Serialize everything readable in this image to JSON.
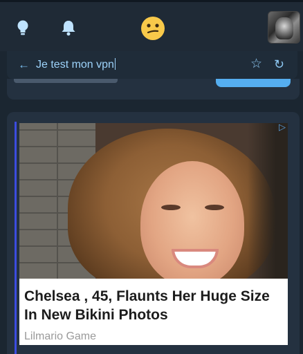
{
  "toolbar": {
    "icons": [
      "lightbulb-icon",
      "bell-icon",
      "smiley-icon",
      "profile-avatar"
    ]
  },
  "address_bar": {
    "title": "Je test mon vpn",
    "back_icon": "arrow-left-icon",
    "star_icon": "star-icon",
    "reload_icon": "reload-icon"
  },
  "ad": {
    "headline": "Chelsea , 45, Flaunts Her Huge Size In New Bikini Photos",
    "sponsor": "Lilmario Game",
    "adchoices_icon": "adchoices-icon"
  },
  "colors": {
    "background": "#1b2631",
    "topbar": "#1f2a36",
    "accent": "#9dd3fb",
    "accent_button": "#55aef0",
    "ad_indicator": "#3c4ce0"
  }
}
